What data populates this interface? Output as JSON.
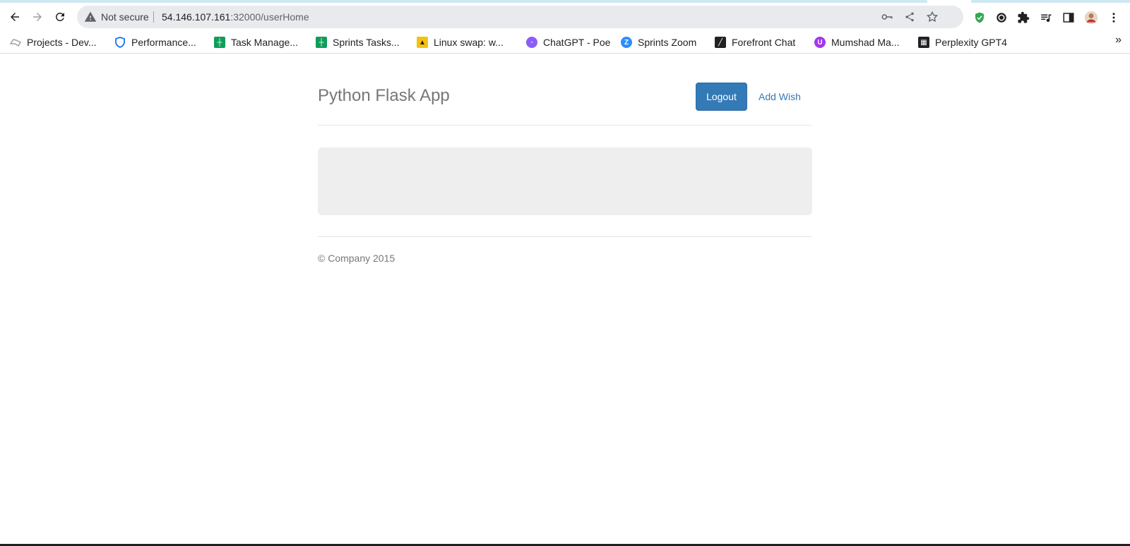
{
  "browser": {
    "security_label": "Not secure",
    "url_host": "54.146.107.161",
    "url_rest": ":32000/userHome",
    "bookmarks": [
      {
        "label": "Projects - Dev...",
        "icon": "azure-devops-icon",
        "color": "#9aa0a6"
      },
      {
        "label": "Performance...",
        "icon": "shield-logo-icon",
        "color": "#1a73e8"
      },
      {
        "label": "Task Manage...",
        "icon": "sheets-icon",
        "color": "#0f9d58"
      },
      {
        "label": "Sprints Tasks...",
        "icon": "sheets-icon",
        "color": "#0f9d58"
      },
      {
        "label": "Linux swap: w...",
        "icon": "linux-tux-icon",
        "color": "#f4c20d"
      },
      {
        "label": "ChatGPT - Poe",
        "icon": "poe-icon",
        "color": "#8b5cf6"
      },
      {
        "label": "Sprints Zoom",
        "icon": "zoom-icon",
        "color": "#2d8cff"
      },
      {
        "label": "Forefront Chat",
        "icon": "forefront-icon",
        "color": "#202124"
      },
      {
        "label": "Mumshad Ma...",
        "icon": "udemy-icon",
        "color": "#a435f0"
      },
      {
        "label": "Perplexity GPT4",
        "icon": "grid-icon",
        "color": "#202124"
      }
    ],
    "more_label": "»"
  },
  "app": {
    "brand": "Python Flask App",
    "logout_label": "Logout",
    "add_wish_label": "Add Wish",
    "footer_text": "© Company 2015"
  }
}
